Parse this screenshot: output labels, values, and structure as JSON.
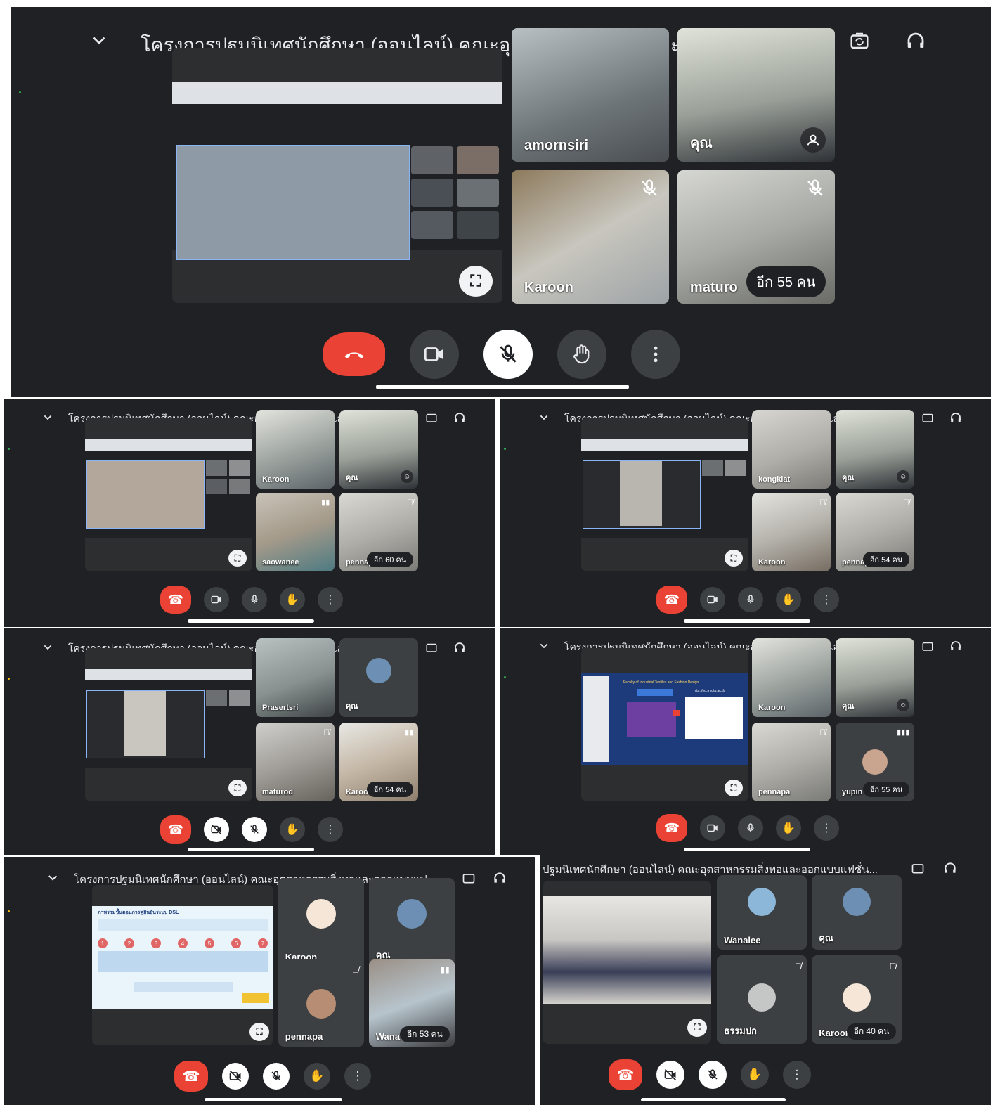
{
  "meeting_title": "โครงการปฐมนิเทศนักศึกษา (ออนไลน์) คณะอุตสาหกรรมสิ่งทอและออกแบบแฟชั่น...",
  "meeting_title_cut": "ปฐมนิเทศนักศึกษา (ออนไลน์) คณะอุตสาหกรรมสิ่งทอและออกแบบแฟชั่น...",
  "icons": {
    "collapse": "chevron-down-icon",
    "camera_switch": "camera-switch-icon",
    "audio": "headphones-icon",
    "end_call": "phone-hangup-icon",
    "camera": "videocam-icon",
    "camera_off": "videocam-off-icon",
    "mic": "mic-icon",
    "mic_off": "mic-off-icon",
    "raise_hand": "hand-icon",
    "more": "more-vert-icon",
    "fullscreen": "fullscreen-icon"
  },
  "colors": {
    "background": "#202124",
    "end_call": "#ea4335",
    "tile": "#3c4043"
  },
  "shots": {
    "s1": {
      "tiles": [
        {
          "name": "amornsiri"
        },
        {
          "name": "คุณ"
        },
        {
          "name": "Karoon"
        },
        {
          "name": "maturo",
          "more": "อีก 55 คน"
        }
      ]
    },
    "s2": {
      "tiles": [
        {
          "name": "Karoon"
        },
        {
          "name": "คุณ"
        },
        {
          "name": "saowanee"
        },
        {
          "name": "pennap",
          "more": "อีก 60 คน"
        }
      ]
    },
    "s3": {
      "tiles": [
        {
          "name": "kongkiat"
        },
        {
          "name": "คุณ"
        },
        {
          "name": "Karoon"
        },
        {
          "name": "pennap",
          "more": "อีก 54 คน"
        }
      ]
    },
    "s4": {
      "tiles": [
        {
          "name": "Prasertsri"
        },
        {
          "name": "คุณ"
        },
        {
          "name": "maturod"
        },
        {
          "name": "Karoor",
          "more": "อีก 54 คน"
        }
      ]
    },
    "s5": {
      "slide_header": "Faculty of Industrial Textiles and Fashion Design",
      "slide_url": "http://eg.rmutp.ac.th",
      "tiles": [
        {
          "name": "Karoon"
        },
        {
          "name": "คุณ"
        },
        {
          "name": "pennapa"
        },
        {
          "name": "yupin",
          "more": "อีก 55 คน"
        }
      ]
    },
    "s6": {
      "slide_title": "ภาพรวมขั้นตอนการคู่ยืนยันระบบ DSL",
      "slide_steps": [
        "1",
        "2",
        "3",
        "4",
        "5",
        "6",
        "7"
      ],
      "tiles": [
        {
          "name": "Karoon"
        },
        {
          "name": "คุณ"
        },
        {
          "name": "pennapa"
        },
        {
          "name": "Wanale",
          "more": "อีก 53 คน"
        }
      ]
    },
    "s7": {
      "tiles": [
        {
          "name": "Wanalee"
        },
        {
          "name": "คุณ"
        },
        {
          "name": "ธรรมปก"
        },
        {
          "name": "Karoor",
          "more": "อีก 40 คน"
        }
      ]
    }
  }
}
